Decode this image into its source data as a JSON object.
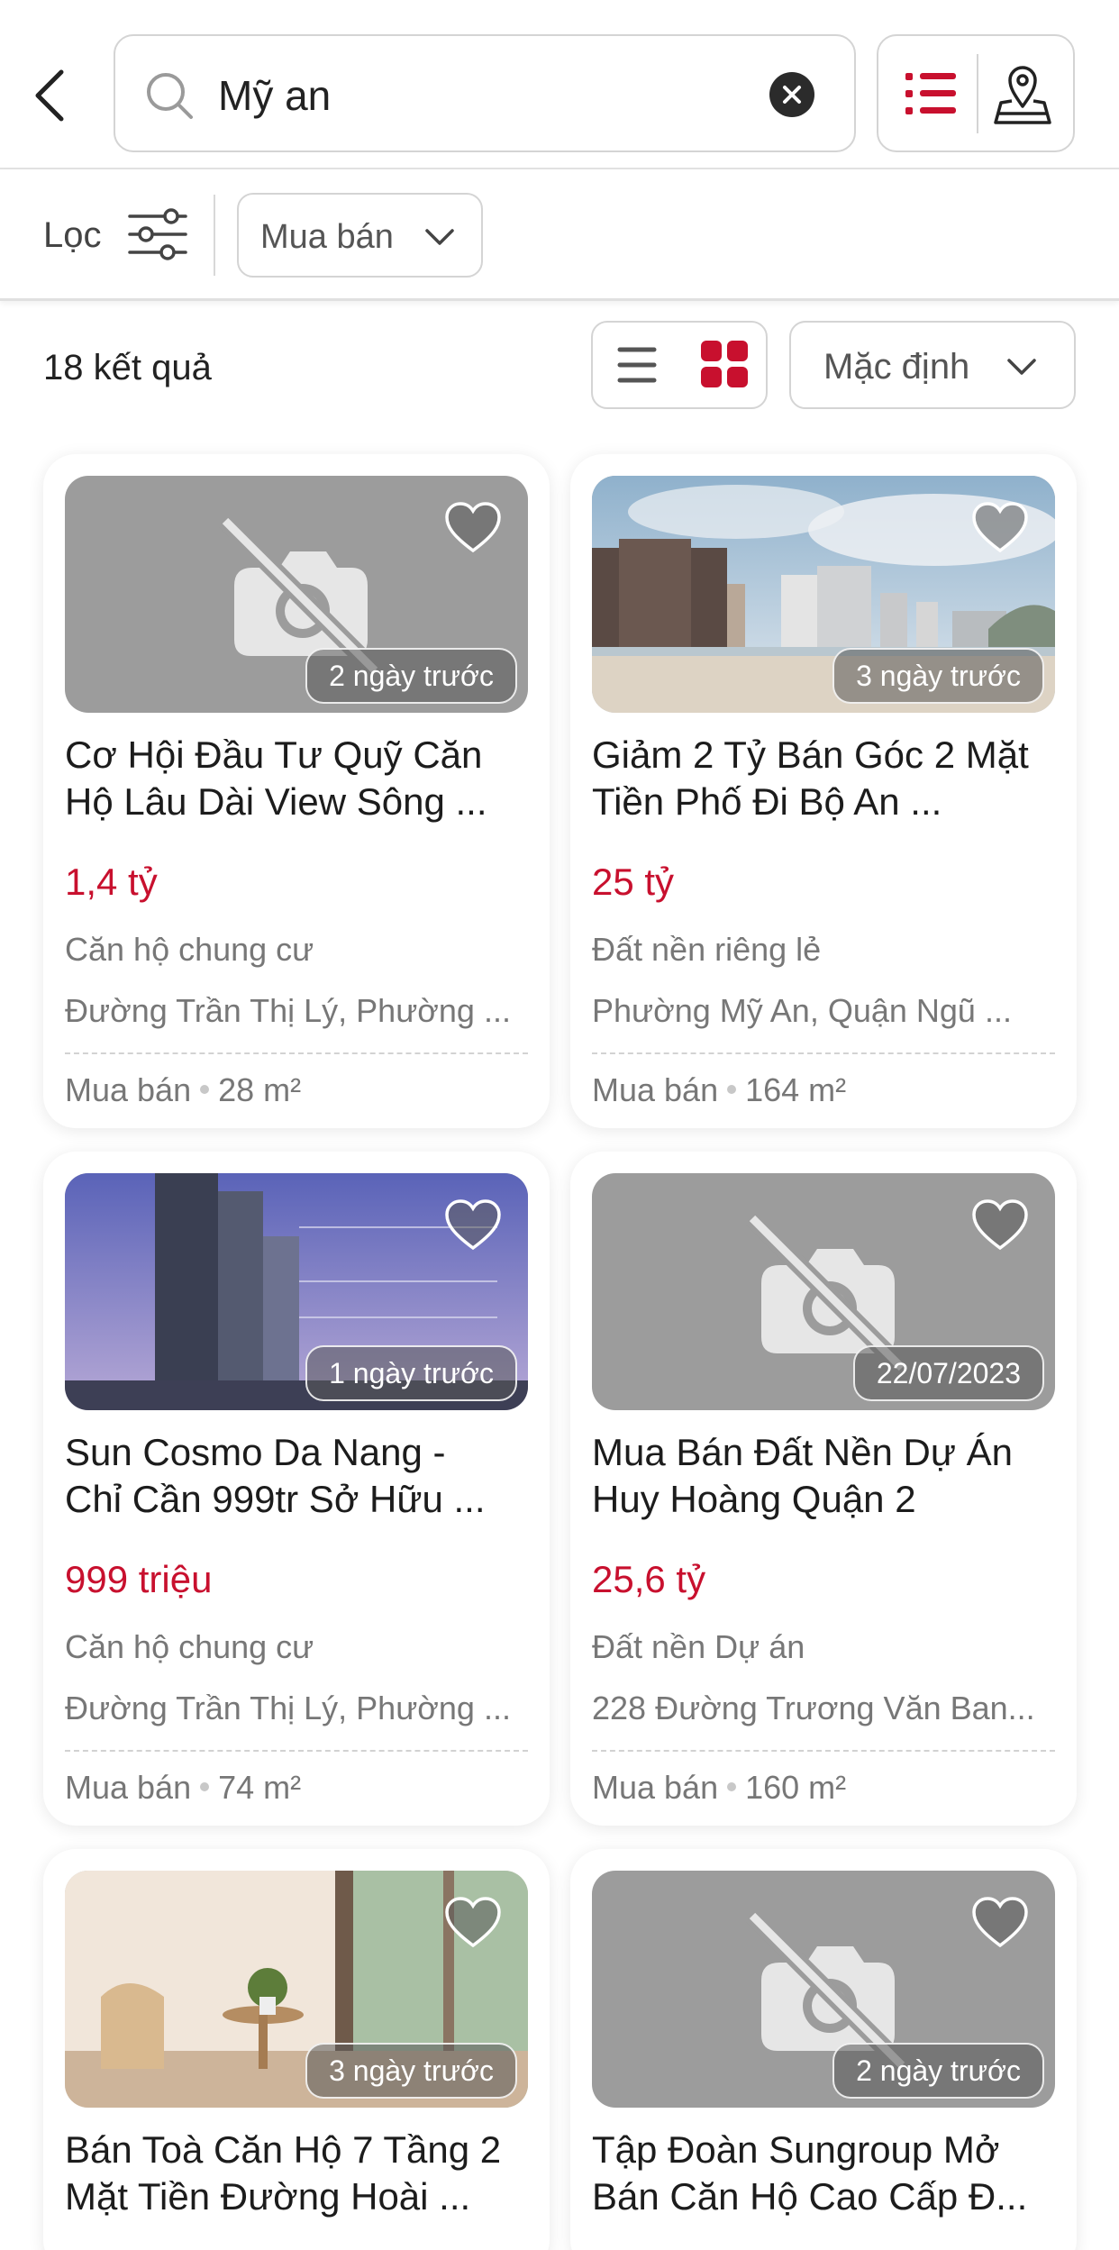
{
  "search": {
    "query": "Mỹ an"
  },
  "filter": {
    "label": "Lọc",
    "transaction_type": "Mua bán"
  },
  "results": {
    "count_label": "18 kết quả",
    "sort_label": "Mặc định"
  },
  "colors": {
    "accent": "#c8102e",
    "text": "#222222",
    "muted": "#777777"
  },
  "listings": [
    {
      "image": "no-photo-icon",
      "date": "2 ngày trước",
      "title_line1": "Cơ Hội Đầu Tư Quỹ Căn",
      "title_line2": "Hộ Lâu Dài View Sông ...",
      "price": "1,4 tỷ",
      "category": "Căn hộ chung cư",
      "address": "Đường Trần Thị Lý, Phường ...",
      "transaction": "Mua bán",
      "area": "28 m²"
    },
    {
      "image": "beach-photo",
      "date": "3 ngày trước",
      "title_line1": "Giảm 2 Tỷ Bán Góc 2 Mặt",
      "title_line2": "Tiền Phố Đi Bộ An ...",
      "price": "25 tỷ",
      "category": "Đất nền riêng lẻ",
      "address": "Phường Mỹ An, Quận Ngũ ...",
      "transaction": "Mua bán",
      "area": "164 m²"
    },
    {
      "image": "tower-photo",
      "date": "1 ngày trước",
      "title_line1": "Sun Cosmo Da Nang -",
      "title_line2": "Chỉ Cần 999tr Sở Hữu ...",
      "price": "999 triệu",
      "category": "Căn hộ chung cư",
      "address": "Đường Trần Thị Lý, Phường ...",
      "transaction": "Mua bán",
      "area": "74 m²"
    },
    {
      "image": "no-photo-icon",
      "date": "22/07/2023",
      "title_line1": "Mua Bán Đất Nền Dự Án",
      "title_line2": "Huy Hoàng Quận 2",
      "price": "25,6 tỷ",
      "category": "Đất nền Dự án",
      "address": "228 Đường Trương Văn Ban...",
      "transaction": "Mua bán",
      "area": "160 m²"
    },
    {
      "image": "interior-photo",
      "date": "3 ngày trước",
      "title_line1": "Bán Toà Căn Hộ 7 Tầng 2",
      "title_line2": "Mặt Tiền Đường Hoài ...",
      "price": "",
      "category": "",
      "address": "",
      "transaction": "",
      "area": ""
    },
    {
      "image": "no-photo-icon",
      "date": "2 ngày trước",
      "title_line1": "Tập Đoàn Sungroup Mở",
      "title_line2": "Bán Căn Hộ Cao Cấp Đ...",
      "price": "",
      "category": "",
      "address": "",
      "transaction": "",
      "area": ""
    }
  ]
}
